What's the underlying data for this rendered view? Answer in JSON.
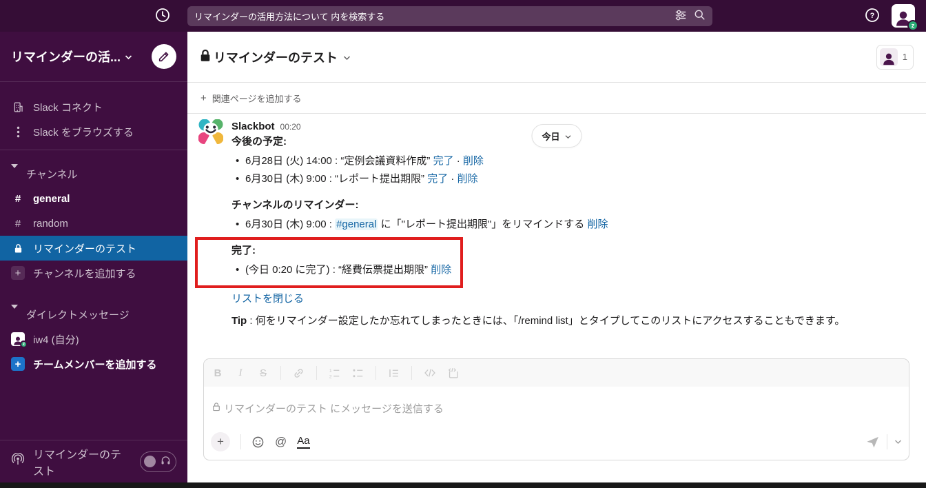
{
  "colors": {
    "topbar_bg": "#350d36",
    "sidebar_bg": "#3f0e40",
    "selected_blue": "#1164a3",
    "link_blue": "#1264a3",
    "channel_mention_bg": "#e8f5fa",
    "annotation_red": "#e01e1e",
    "presence_green": "#2bac76"
  },
  "topbar": {
    "search_value": "リマインダーの活用方法について 内を検索する"
  },
  "sidebar": {
    "workspace_name": "リマインダーの活...",
    "slack_connect": "Slack コネクト",
    "browse_slack": "Slack をブラウズする",
    "channels_heading": "チャンネル",
    "channels": [
      {
        "label": "general"
      },
      {
        "label": "random"
      },
      {
        "label": "リマインダーのテスト"
      }
    ],
    "add_channel": "チャンネルを追加する",
    "dm_heading": "ダイレクトメッセージ",
    "dm_self": "iw4 (自分)",
    "add_member": "チームメンバーを追加する",
    "footer_channel": "リマインダーのテスト"
  },
  "channel_header": {
    "name": "リマインダーのテスト",
    "member_count": "1",
    "add_pages": "関連ページを追加する"
  },
  "date_pill": "今日",
  "message": {
    "author": "Slackbot",
    "time": "00:20",
    "upcoming_heading": "今後の予定:",
    "upcoming": [
      {
        "text": "6月28日 (火) 14:00 : “定例会議資料作成” ",
        "done": "完了",
        "sep": "·",
        "delete": "削除"
      },
      {
        "text": "6月30日 (木) 9:00 : “レポート提出期限” ",
        "done": "完了",
        "sep": "·",
        "delete": "削除"
      }
    ],
    "channel_heading": "チャンネルのリマインダー:",
    "channel_item": {
      "pre": "6月30日 (木) 9:00 : ",
      "channel": "#general",
      "post": " に「\"レポート提出期限\"」をリマインドする ",
      "delete": "削除"
    },
    "completed_heading": "完了:",
    "completed_item": {
      "text": "(今日 0:20 に完了) : “経費伝票提出期限” ",
      "delete": "削除"
    },
    "close_list": "リストを閉じる",
    "tip_label": "Tip",
    "tip_text": " : 何をリマインダー設定したか忘れてしまったときには、「/remind list」とタイプしてこのリストにアクセスすることもできます。"
  },
  "composer": {
    "placeholder": "リマインダーのテスト にメッセージを送信する",
    "bold_label": "B",
    "italic_label": "I",
    "strike_label": "S",
    "mention_label": "@",
    "format_label": "Aa"
  }
}
